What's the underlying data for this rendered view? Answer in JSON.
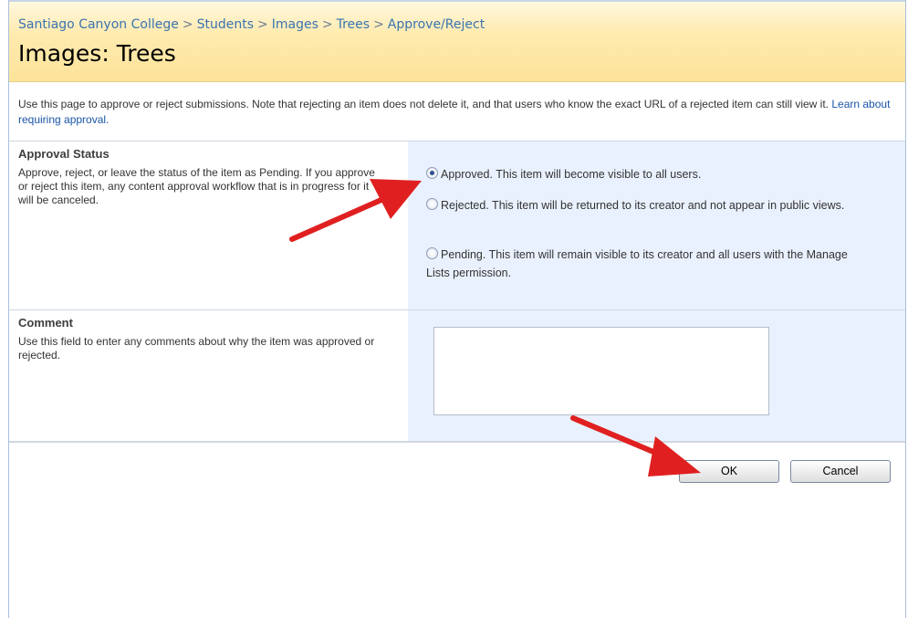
{
  "breadcrumb": {
    "items": [
      "Santiago Canyon College",
      "Students",
      "Images",
      "Trees"
    ],
    "separator": ">",
    "current": "Approve/Reject"
  },
  "page": {
    "title": "Images: Trees"
  },
  "intro": {
    "text": "Use this page to approve or reject submissions. Note that rejecting an item does not delete it, and that users who know the exact URL of a rejected item can still view it.",
    "link": "Learn about requiring approval."
  },
  "approval": {
    "title": "Approval Status",
    "description": "Approve, reject, or leave the status of the item as Pending. If you approve or reject this item, any content approval workflow that is in progress for it will be canceled.",
    "options": [
      {
        "label": "Approved. This item will become visible to all users.",
        "checked": true
      },
      {
        "label": "Rejected. This item will be returned to its creator and not appear in public views.",
        "checked": false
      },
      {
        "label": "Pending. This item will remain visible to its creator and all users with the Manage Lists permission.",
        "checked": false
      }
    ]
  },
  "comment": {
    "title": "Comment",
    "description": "Use this field to enter any comments about why the item was approved or rejected.",
    "value": ""
  },
  "buttons": {
    "ok": "OK",
    "cancel": "Cancel"
  },
  "annotations": {
    "arrow_color": "#e02020"
  }
}
